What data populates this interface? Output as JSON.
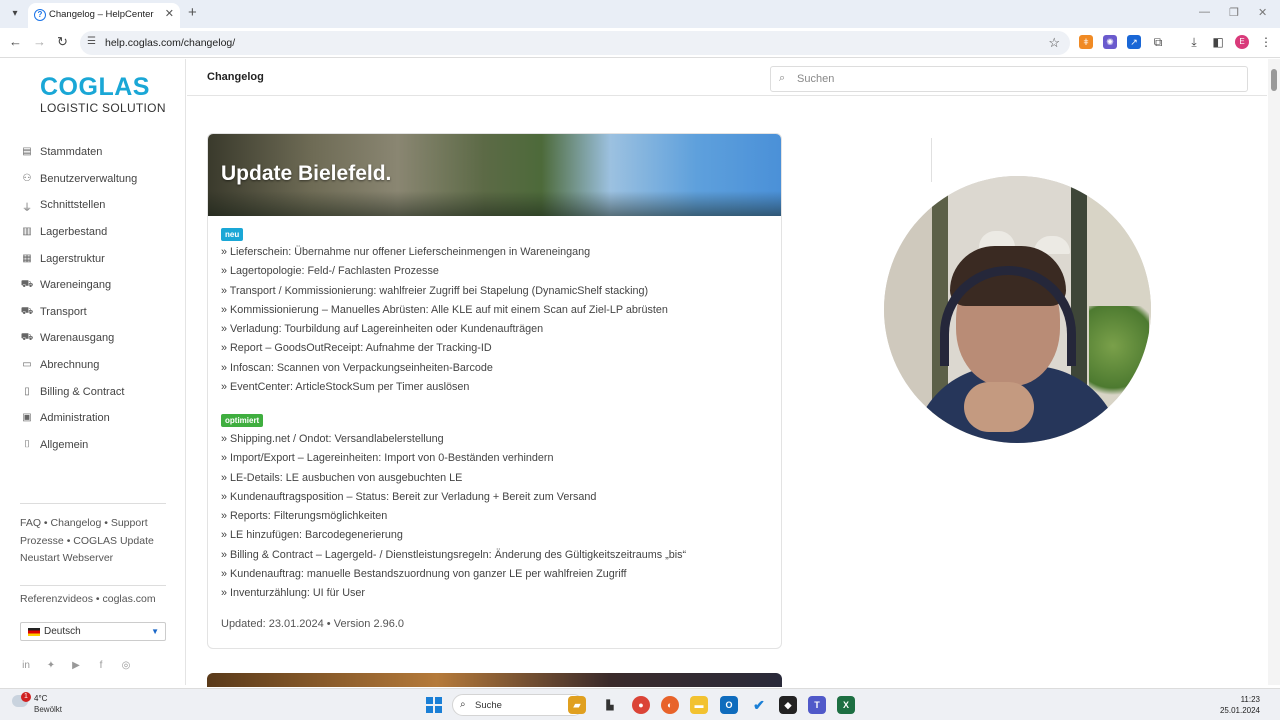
{
  "browser": {
    "tab_title": "Changelog – HelpCenter",
    "url": "help.coglas.com/changelog/",
    "profile_initial": "E"
  },
  "sidebar": {
    "logo_main": "COGLAS",
    "logo_sub": "LOGISTIC SOLUTION",
    "items": [
      {
        "label": "Stammdaten",
        "icon": "document-icon"
      },
      {
        "label": "Benutzerverwaltung",
        "icon": "users-icon"
      },
      {
        "label": "Schnittstellen",
        "icon": "plug-icon"
      },
      {
        "label": "Lagerbestand",
        "icon": "stock-icon"
      },
      {
        "label": "Lagerstruktur",
        "icon": "warehouse-icon"
      },
      {
        "label": "Wareneingang",
        "icon": "inbound-truck-icon"
      },
      {
        "label": "Transport",
        "icon": "truck-icon"
      },
      {
        "label": "Warenausgang",
        "icon": "outbound-truck-icon"
      },
      {
        "label": "Abrechnung",
        "icon": "receipt-icon"
      },
      {
        "label": "Billing & Contract",
        "icon": "contract-icon"
      },
      {
        "label": "Administration",
        "icon": "admin-icon"
      },
      {
        "label": "Allgemein",
        "icon": "bookmark-icon"
      }
    ],
    "footer_links": {
      "faq": "FAQ",
      "changelog": "Changelog",
      "support": "Support",
      "prozesse": "Prozesse",
      "update": "COGLAS Update",
      "neustart": "Neustart Webserver",
      "referenzvideos": "Referenzvideos",
      "website": "coglas.com"
    },
    "language": "Deutsch"
  },
  "header": {
    "title": "Changelog",
    "search_placeholder": "Suchen"
  },
  "changelog": {
    "title": "Update Bielefeld.",
    "badge_new": "neu",
    "new_items": [
      "» Lieferschein: Übernahme nur offener Lieferscheinmengen in Wareneingang",
      "» Lagertopologie: Feld-/ Fachlasten Prozesse",
      "» Transport / Kommissionierung: wahlfreier Zugriff bei Stapelung (DynamicShelf stacking)",
      "» Kommissionierung – Manuelles Abrüsten: Alle KLE auf mit einem Scan auf Ziel-LP abrüsten",
      "» Verladung: Tourbildung auf Lagereinheiten oder Kundenaufträgen",
      "» Report – GoodsOutReceipt: Aufnahme der Tracking-ID",
      "» Infoscan: Scannen von Verpackungseinheiten-Barcode",
      "» EventCenter: ArticleStockSum per Timer auslösen"
    ],
    "badge_optimized": "optimiert",
    "optimized_items": [
      "» Shipping.net / Ondot: Versandlabelerstellung",
      "» Import/Export – Lagereinheiten: Import von 0-Beständen verhindern",
      "» LE-Details: LE ausbuchen von ausgebuchten LE",
      "» Kundenauftragsposition – Status: Bereit zur Verladung + Bereit zum Versand",
      "» Reports: Filterungsmöglichkeiten",
      "» LE hinzufügen: Barcodegenerierung",
      "» Billing & Contract – Lagergeld- / Dienstleistungsregeln: Änderung des Gültigkeitszeitraums „bis“",
      "» Kundenauftrag: manuelle Bestandszuordnung von ganzer LE per wahlfreien Zugriff",
      "» Inventurzählung: UI für User"
    ],
    "footer": "Updated: 23.01.2024  •  Version 2.96.0"
  },
  "taskbar": {
    "notification_count": "1",
    "temperature": "4°C",
    "condition": "Bewölkt",
    "search_label": "Suche",
    "time": "11:23",
    "date": "25.01.2024"
  },
  "colors": {
    "brand": "#1aa7d6",
    "badge_new": "#1aa7d6",
    "badge_optimized": "#3fae3f"
  }
}
